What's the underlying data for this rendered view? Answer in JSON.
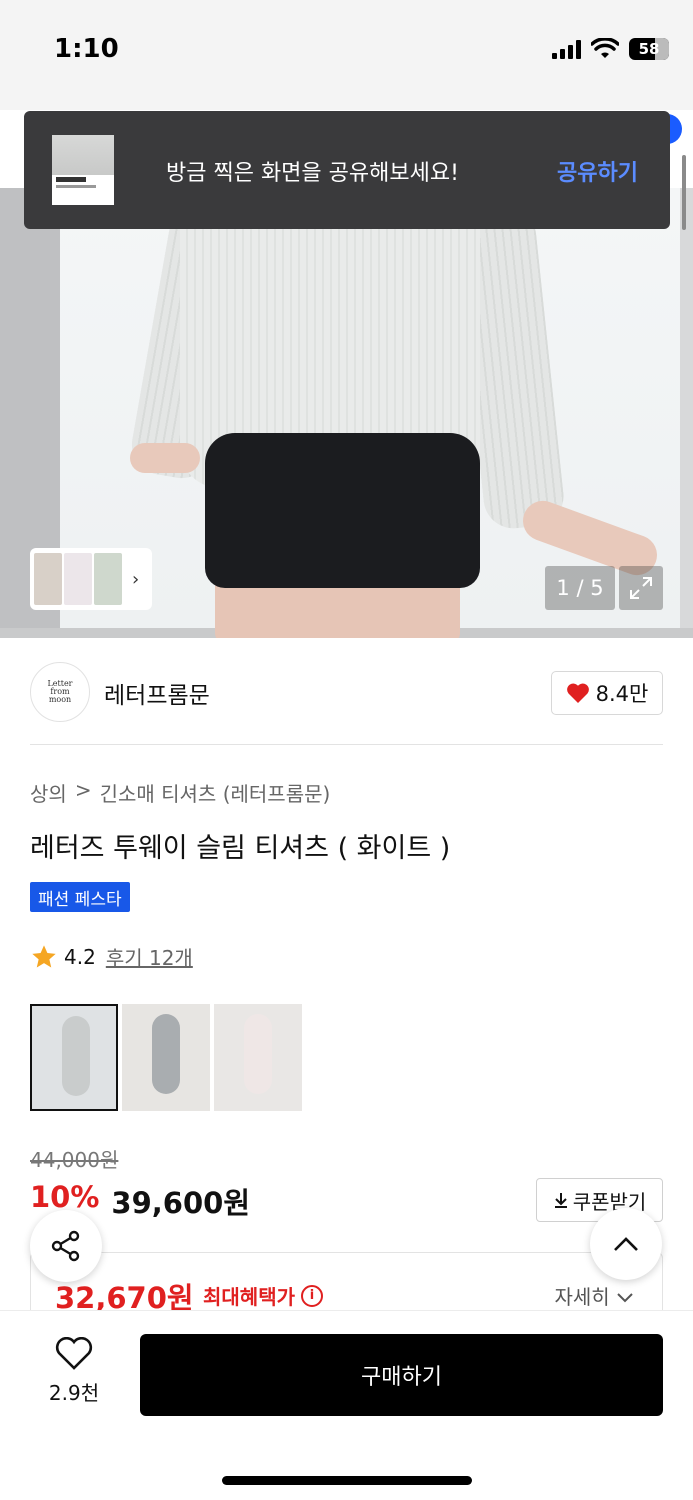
{
  "status_bar": {
    "time": "1:10",
    "battery": "58"
  },
  "toast": {
    "message": "방금 찍은 화면을 공유해보세요!",
    "action": "공유하기"
  },
  "gallery": {
    "counter": "1 / 5"
  },
  "brand": {
    "logo_text": "Letter from moon",
    "name": "레터프롬문",
    "likes": "8.4만"
  },
  "breadcrumb": {
    "category": "상의",
    "separator": ">",
    "subcategory": "긴소매 티셔츠 (레터프롬문)"
  },
  "product": {
    "title": "레터즈 투웨이 슬림 티셔츠 ( 화이트 )",
    "badge": "패션 페스타",
    "rating": "4.2",
    "reviews": "후기 12개"
  },
  "price": {
    "original": "44,000원",
    "discount": "10%",
    "sale": "39,600원",
    "coupon_button": "쿠폰받기",
    "max_benefit_price": "32,670원",
    "max_benefit_label": "최대혜택가",
    "detail": "자세히"
  },
  "bottom_bar": {
    "wish_count": "2.9천",
    "buy_label": "구매하기"
  },
  "colors": {
    "accent_red": "#e02020",
    "badge_blue": "#1858e8",
    "link_blue": "#5b8cff"
  }
}
